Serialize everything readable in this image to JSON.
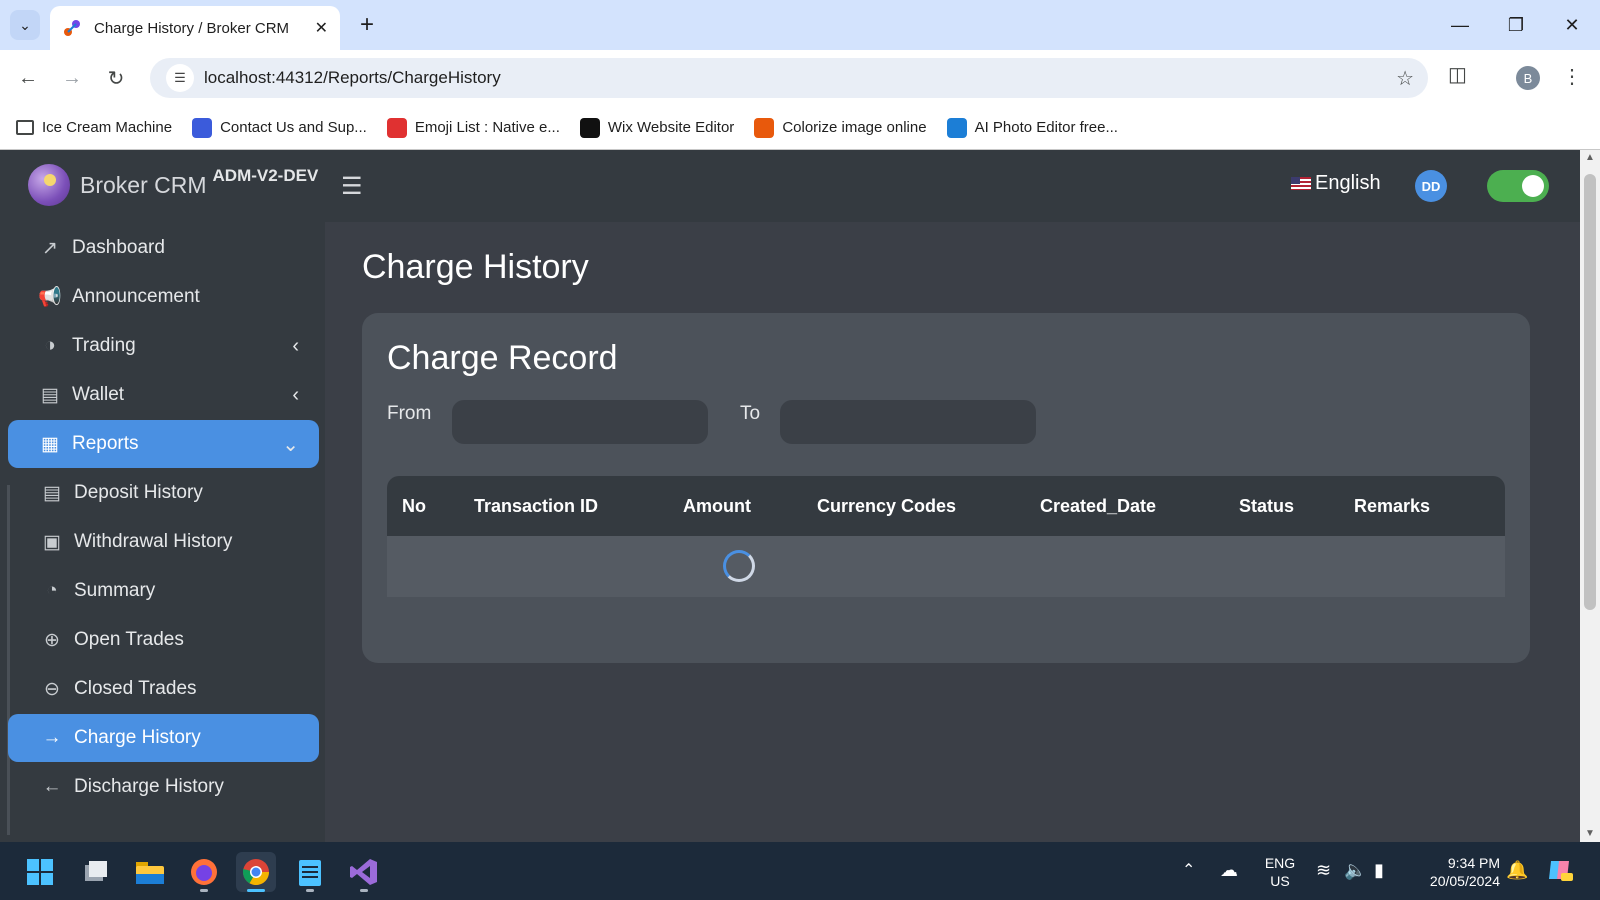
{
  "browser": {
    "tab_title": "Charge History / Broker CRM",
    "url": "localhost:44312/Reports/ChargeHistory",
    "profile_initial": "B",
    "bookmarks": [
      {
        "label": "Ice Cream Machine",
        "icon": "folder-icon",
        "color": "#444746"
      },
      {
        "label": "Contact Us and Sup...",
        "icon": "contact-site-icon",
        "color": "#3b5bdb"
      },
      {
        "label": "Emoji List : Native e...",
        "icon": "emoji-site-icon",
        "color": "#e03131"
      },
      {
        "label": "Wix Website Editor",
        "icon": "wix-icon",
        "color": "#111111"
      },
      {
        "label": "Colorize image online",
        "icon": "colorize-icon",
        "color": "#e8590c"
      },
      {
        "label": "AI Photo Editor free...",
        "icon": "photo-editor-icon",
        "color": "#1c7ed6"
      }
    ]
  },
  "app": {
    "brand_name": "Broker CRM",
    "env_label": "ADM-V2-DEV",
    "language": "English",
    "user_initials": "DD",
    "theme_toggle_on": true
  },
  "sidebar": {
    "items": [
      {
        "label": "Dashboard",
        "icon": "chart-line-icon"
      },
      {
        "label": "Announcement",
        "icon": "megaphone-icon"
      },
      {
        "label": "Trading",
        "icon": "globe-icon",
        "chevron": "left"
      },
      {
        "label": "Wallet",
        "icon": "wallet-icon",
        "chevron": "left"
      },
      {
        "label": "Reports",
        "icon": "table-icon",
        "chevron": "down",
        "active": true
      }
    ],
    "sub_items": [
      {
        "label": "Deposit History",
        "icon": "wallet-icon"
      },
      {
        "label": "Withdrawal History",
        "icon": "money-icon"
      },
      {
        "label": "Summary",
        "icon": "pie-chart-icon"
      },
      {
        "label": "Open Trades",
        "icon": "file-plus-icon"
      },
      {
        "label": "Closed Trades",
        "icon": "file-minus-icon"
      },
      {
        "label": "Charge History",
        "icon": "arrow-right-icon",
        "active": true
      },
      {
        "label": "Discharge History",
        "icon": "arrow-left-icon"
      }
    ]
  },
  "main": {
    "page_title": "Charge History",
    "card_title": "Charge Record",
    "from_label": "From",
    "to_label": "To",
    "from_value": "",
    "to_value": "",
    "table": {
      "columns": [
        "No",
        "Transaction ID",
        "Amount",
        "Currency Codes",
        "Created_Date",
        "Status",
        "Remarks"
      ],
      "loading": true,
      "rows": []
    }
  },
  "taskbar": {
    "apps": [
      "windows-start-icon",
      "task-view-icon",
      "file-explorer-icon",
      "firefox-icon",
      "chrome-icon",
      "notepad-icon",
      "visual-studio-icon"
    ],
    "lang_top": "ENG",
    "lang_bottom": "US",
    "time": "9:34 PM",
    "date": "20/05/2024"
  },
  "colors": {
    "accent": "#4a90e2",
    "sidebar_bg": "#343a40",
    "content_bg": "#3b3f47",
    "card_bg": "#4c525a",
    "toggle_on": "#4caf50"
  }
}
